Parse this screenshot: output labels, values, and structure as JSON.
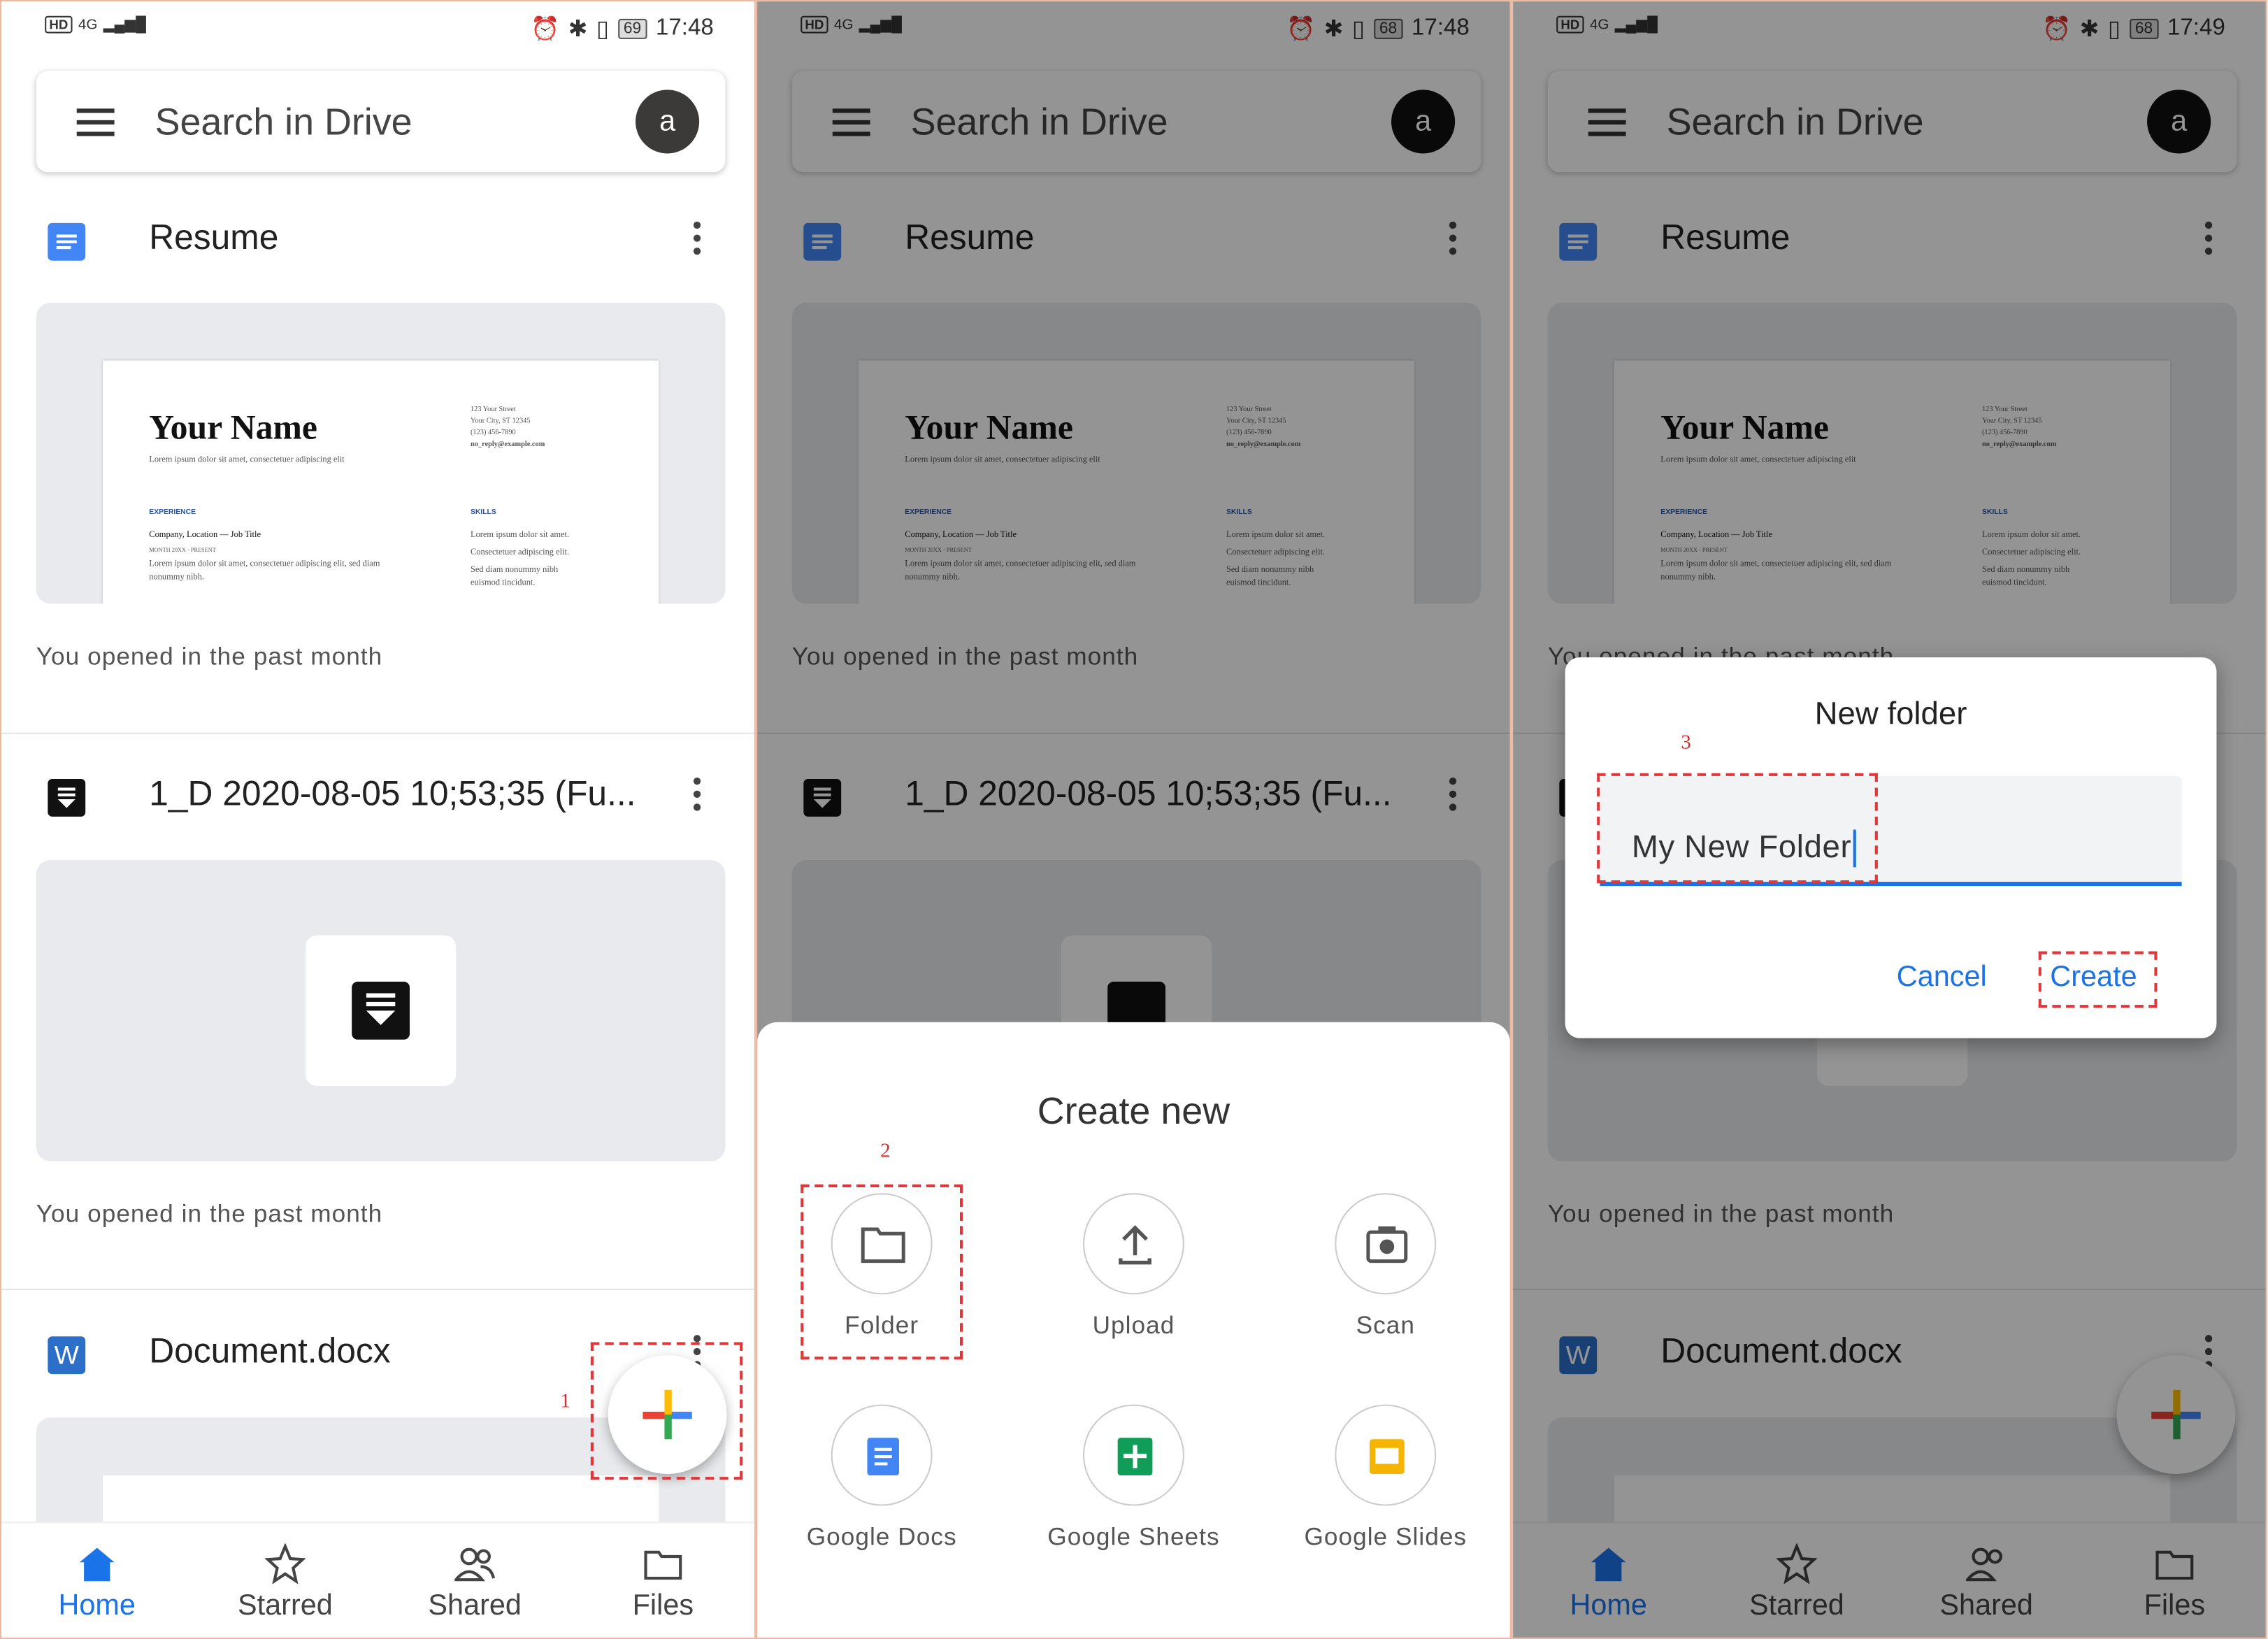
{
  "status_p1": {
    "network": "4G",
    "battery": "69",
    "time": "17:48"
  },
  "status_p2": {
    "network": "4G",
    "battery": "68",
    "time": "17:48"
  },
  "status_p3": {
    "network": "4G",
    "battery": "68",
    "time": "17:49"
  },
  "status_hd": "HD",
  "search": {
    "placeholder": "Search in Drive",
    "avatar_letter": "a"
  },
  "files": [
    {
      "name": "Resume",
      "icon": "google-docs-icon",
      "caption": "You opened in the past month"
    },
    {
      "name": "1_D 2020-08-05 10;53;35 (Fu...",
      "icon": "download-doc-icon",
      "caption": "You opened in the past month"
    },
    {
      "name": "Document.docx",
      "icon": "word-icon"
    }
  ],
  "resume_preview": {
    "name": "Your Name",
    "tagline": "Lorem ipsum dolor sit amet, consectetuer adipiscing elit",
    "address": [
      "123 Your Street",
      "Your City, ST 12345",
      "(123) 456-7890",
      "no_reply@example.com"
    ],
    "experience_heading": "EXPERIENCE",
    "experience_title": "Company, Location — Job Title",
    "experience_dates": "MONTH 20XX - PRESENT",
    "experience_text": [
      "Lorem ipsum dolor sit amet, consectetuer adipiscing elit, sed diam",
      "nonummy nibh."
    ],
    "skills_heading": "SKILLS",
    "skills_text": [
      "Lorem ipsum dolor sit amet.",
      "Consectetuer adipiscing elit.",
      "Sed diam nonummy nibh",
      "euismod tincidunt."
    ]
  },
  "nav": [
    {
      "label": "Home",
      "icon": "home-icon",
      "active": true
    },
    {
      "label": "Starred",
      "icon": "star-icon"
    },
    {
      "label": "Shared",
      "icon": "people-icon"
    },
    {
      "label": "Files",
      "icon": "folder-icon"
    }
  ],
  "markers": {
    "step1": "1",
    "step2": "2",
    "step3": "3"
  },
  "create_new": {
    "title": "Create new",
    "options": [
      {
        "label": "Folder",
        "icon": "folder-icon"
      },
      {
        "label": "Upload",
        "icon": "upload-icon"
      },
      {
        "label": "Scan",
        "icon": "camera-icon"
      },
      {
        "label": "Google Docs",
        "icon": "google-docs-icon"
      },
      {
        "label": "Google Sheets",
        "icon": "google-sheets-icon"
      },
      {
        "label": "Google Slides",
        "icon": "google-slides-icon"
      }
    ]
  },
  "new_folder_dialog": {
    "title": "New folder",
    "input_value": "My New Folder",
    "cancel_label": "Cancel",
    "create_label": "Create"
  },
  "colors": {
    "accent": "#1a73e8",
    "annotation": "#e0383a",
    "docs_blue": "#4285f4",
    "sheets_green": "#0f9d58",
    "slides_yellow": "#f4b400"
  }
}
